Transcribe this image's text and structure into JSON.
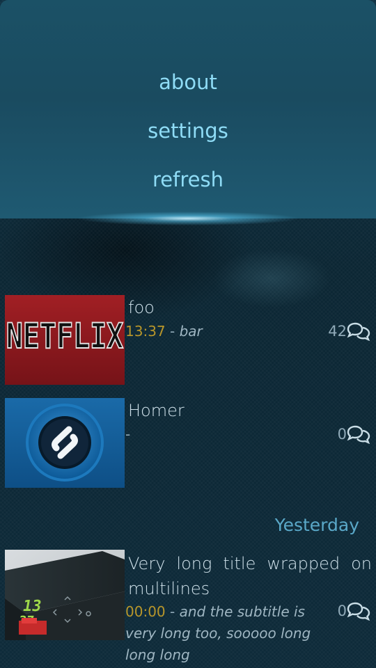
{
  "menu": {
    "items": [
      "about",
      "settings",
      "refresh"
    ]
  },
  "list": {
    "items": [
      {
        "thumb_label": "NETFLIX",
        "title": "foo",
        "time": "13:37",
        "separator": " - ",
        "subtitle": "bar",
        "count": "42"
      },
      {
        "thumb_label": "Shazam",
        "title": "Homer",
        "time": "",
        "separator": "-",
        "subtitle": "",
        "count": "0"
      },
      {
        "thumb_label": "box",
        "title": "Very long title wrapped on multilines",
        "time": "00:00",
        "separator": " - ",
        "subtitle": "and the subtitle is very long too, sooooo long long long",
        "count": "0"
      }
    ],
    "section_header": "Yesterday"
  },
  "colors": {
    "accent": "#8fdcf6",
    "time": "#b8962a",
    "section": "#5aa8c8",
    "netflix_red": "#8a1a1e"
  },
  "icons": [
    "comments-icon"
  ]
}
